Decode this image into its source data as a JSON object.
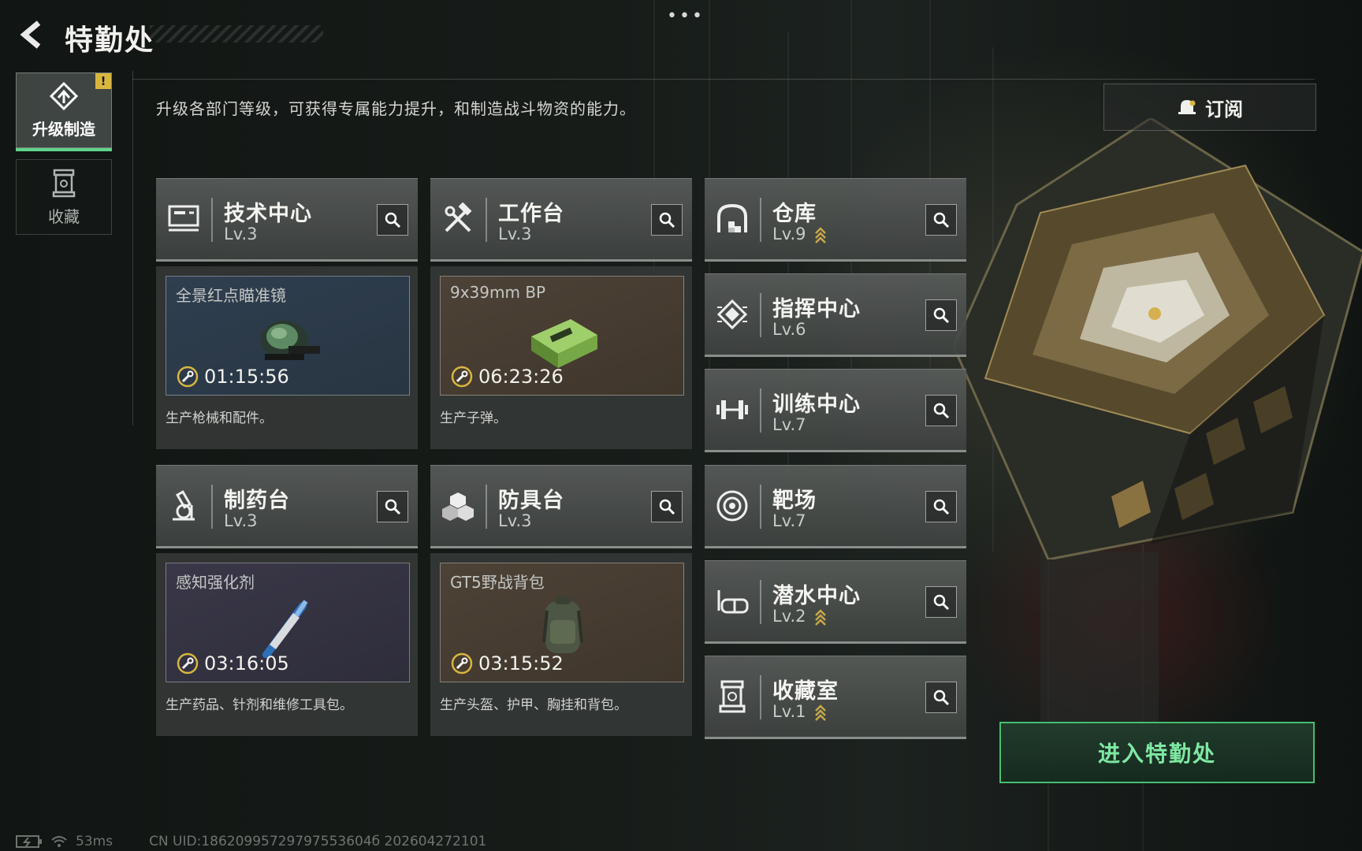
{
  "header": {
    "title": "特勤处"
  },
  "sidebar": {
    "tabs": [
      {
        "label": "升级制造",
        "active": true,
        "badge": "!"
      },
      {
        "label": "收藏",
        "active": false
      }
    ]
  },
  "description": "升级各部门等级，可获得专属能力提升，和制造战斗物资的能力。",
  "subscribe": {
    "label": "订阅"
  },
  "departments": [
    {
      "name": "技术中心",
      "level": "Lv.3",
      "icon": "monitor-icon"
    },
    {
      "name": "工作台",
      "level": "Lv.3",
      "icon": "hammer-wrench-icon"
    },
    {
      "name": "仓库",
      "level": "Lv.9",
      "icon": "warehouse-icon",
      "upgradable": true
    },
    {
      "name": "指挥中心",
      "level": "Lv.6",
      "icon": "chip-icon"
    },
    {
      "name": "训练中心",
      "level": "Lv.7",
      "icon": "dumbbell-icon"
    },
    {
      "name": "制药台",
      "level": "Lv.3",
      "icon": "microscope-icon"
    },
    {
      "name": "防具台",
      "level": "Lv.3",
      "icon": "cubes-icon"
    },
    {
      "name": "靶场",
      "level": "Lv.7",
      "icon": "target-icon"
    },
    {
      "name": "潜水中心",
      "level": "Lv.2",
      "icon": "diving-mask-icon",
      "upgradable": true
    },
    {
      "name": "收藏室",
      "level": "Lv.1",
      "icon": "collection-icon",
      "upgradable": true
    }
  ],
  "production": [
    {
      "item": "全景红点瞄准镜",
      "timer": "01:15:56",
      "desc": "生产枪械和配件。",
      "theme": "blue",
      "icon": "red-dot-sight-icon"
    },
    {
      "item": "9x39mm BP",
      "timer": "06:23:26",
      "desc": "生产子弹。",
      "theme": "brown",
      "icon": "ammo-box-icon"
    },
    {
      "item": "感知强化剂",
      "timer": "03:16:05",
      "desc": "生产药品、针剂和维修工具包。",
      "theme": "purple",
      "icon": "injector-icon"
    },
    {
      "item": "GT5野战背包",
      "timer": "03:15:52",
      "desc": "生产头盔、护甲、胸挂和背包。",
      "theme": "brown",
      "icon": "backpack-icon"
    }
  ],
  "enter_button": {
    "label": "进入特勤处"
  },
  "status": {
    "ping": "53ms",
    "uid": "CN UID:18620995729797553604б 202604272101"
  },
  "colors": {
    "accent": "#45c070",
    "accent_text": "#7ee8a2",
    "upgrade": "#c9a84a",
    "badge": "#d8b640"
  }
}
